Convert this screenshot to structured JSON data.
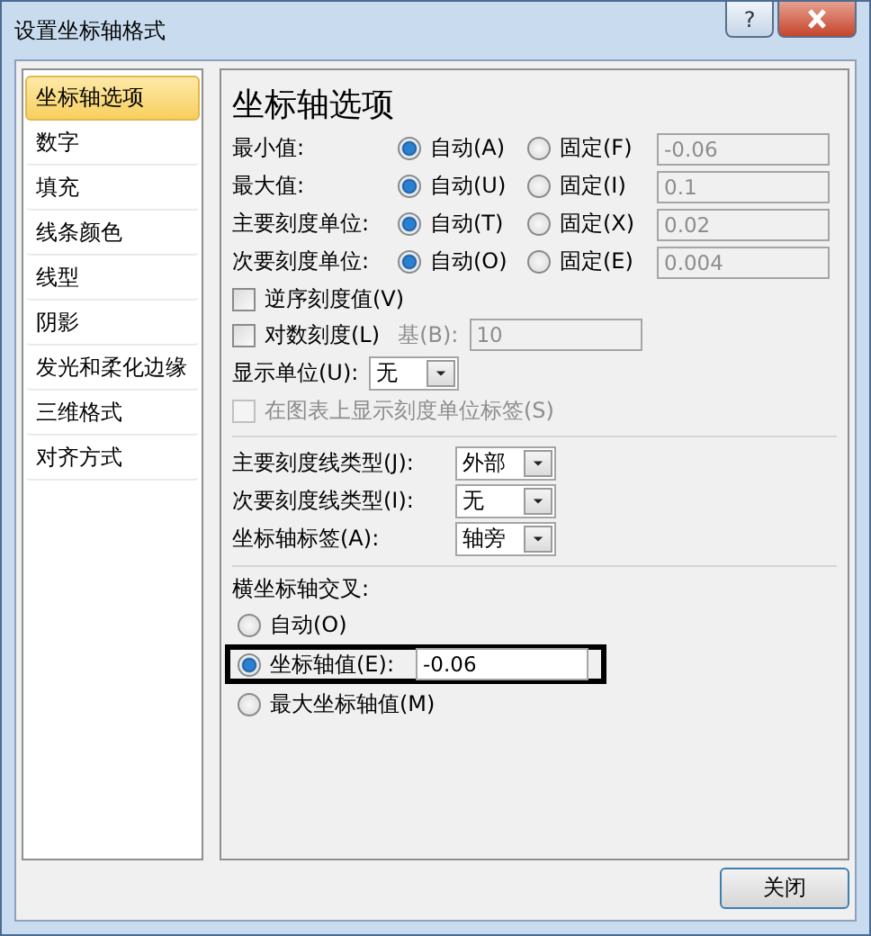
{
  "window": {
    "title": "设置坐标轴格式",
    "help": "?"
  },
  "sidebar": {
    "items": [
      {
        "label": "坐标轴选项",
        "selected": true
      },
      {
        "label": "数字",
        "selected": false
      },
      {
        "label": "填充",
        "selected": false
      },
      {
        "label": "线条颜色",
        "selected": false
      },
      {
        "label": "线型",
        "selected": false
      },
      {
        "label": "阴影",
        "selected": false
      },
      {
        "label": "发光和柔化边缘",
        "selected": false
      },
      {
        "label": "三维格式",
        "selected": false
      },
      {
        "label": "对齐方式",
        "selected": false
      }
    ]
  },
  "panel": {
    "heading": "坐标轴选项",
    "bounds": [
      {
        "label": "最小值:",
        "options": [
          {
            "label": "自动(A)",
            "selected": true
          },
          {
            "label": "固定(F)",
            "selected": false
          }
        ],
        "value": "-0.06",
        "disabled": true
      },
      {
        "label": "最大值:",
        "options": [
          {
            "label": "自动(U)",
            "selected": true
          },
          {
            "label": "固定(I)",
            "selected": false
          }
        ],
        "value": "0.1",
        "disabled": true
      },
      {
        "label": "主要刻度单位:",
        "options": [
          {
            "label": "自动(T)",
            "selected": true
          },
          {
            "label": "固定(X)",
            "selected": false
          }
        ],
        "value": "0.02",
        "disabled": true
      },
      {
        "label": "次要刻度单位:",
        "options": [
          {
            "label": "自动(O)",
            "selected": true
          },
          {
            "label": "固定(E)",
            "selected": false
          }
        ],
        "value": "0.004",
        "disabled": true
      }
    ],
    "reverse": {
      "label": "逆序刻度值(V)",
      "checked": false
    },
    "log_scale": {
      "label": "对数刻度(L)",
      "checked": false,
      "base_label": "基(B):",
      "base_value": "10",
      "disabled": true
    },
    "display_unit": {
      "label": "显示单位(U):",
      "value": "无"
    },
    "show_unit_label": {
      "label": "在图表上显示刻度单位标签(S)",
      "checked": false,
      "disabled": true
    },
    "tick_settings": [
      {
        "label": "主要刻度线类型(J):",
        "value": "外部"
      },
      {
        "label": "次要刻度线类型(I):",
        "value": "无"
      },
      {
        "label": "坐标轴标签(A):",
        "value": "轴旁"
      }
    ],
    "crosses": {
      "label": "横坐标轴交叉:",
      "options": [
        {
          "label": "自动(O)",
          "selected": false,
          "highlighted": false
        },
        {
          "label": "坐标轴值(E):",
          "selected": true,
          "highlighted": true,
          "value": "-0.06"
        },
        {
          "label": "最大坐标轴值(M)",
          "selected": false,
          "highlighted": false
        }
      ]
    }
  },
  "buttons": [
    {
      "label": "关闭"
    }
  ]
}
